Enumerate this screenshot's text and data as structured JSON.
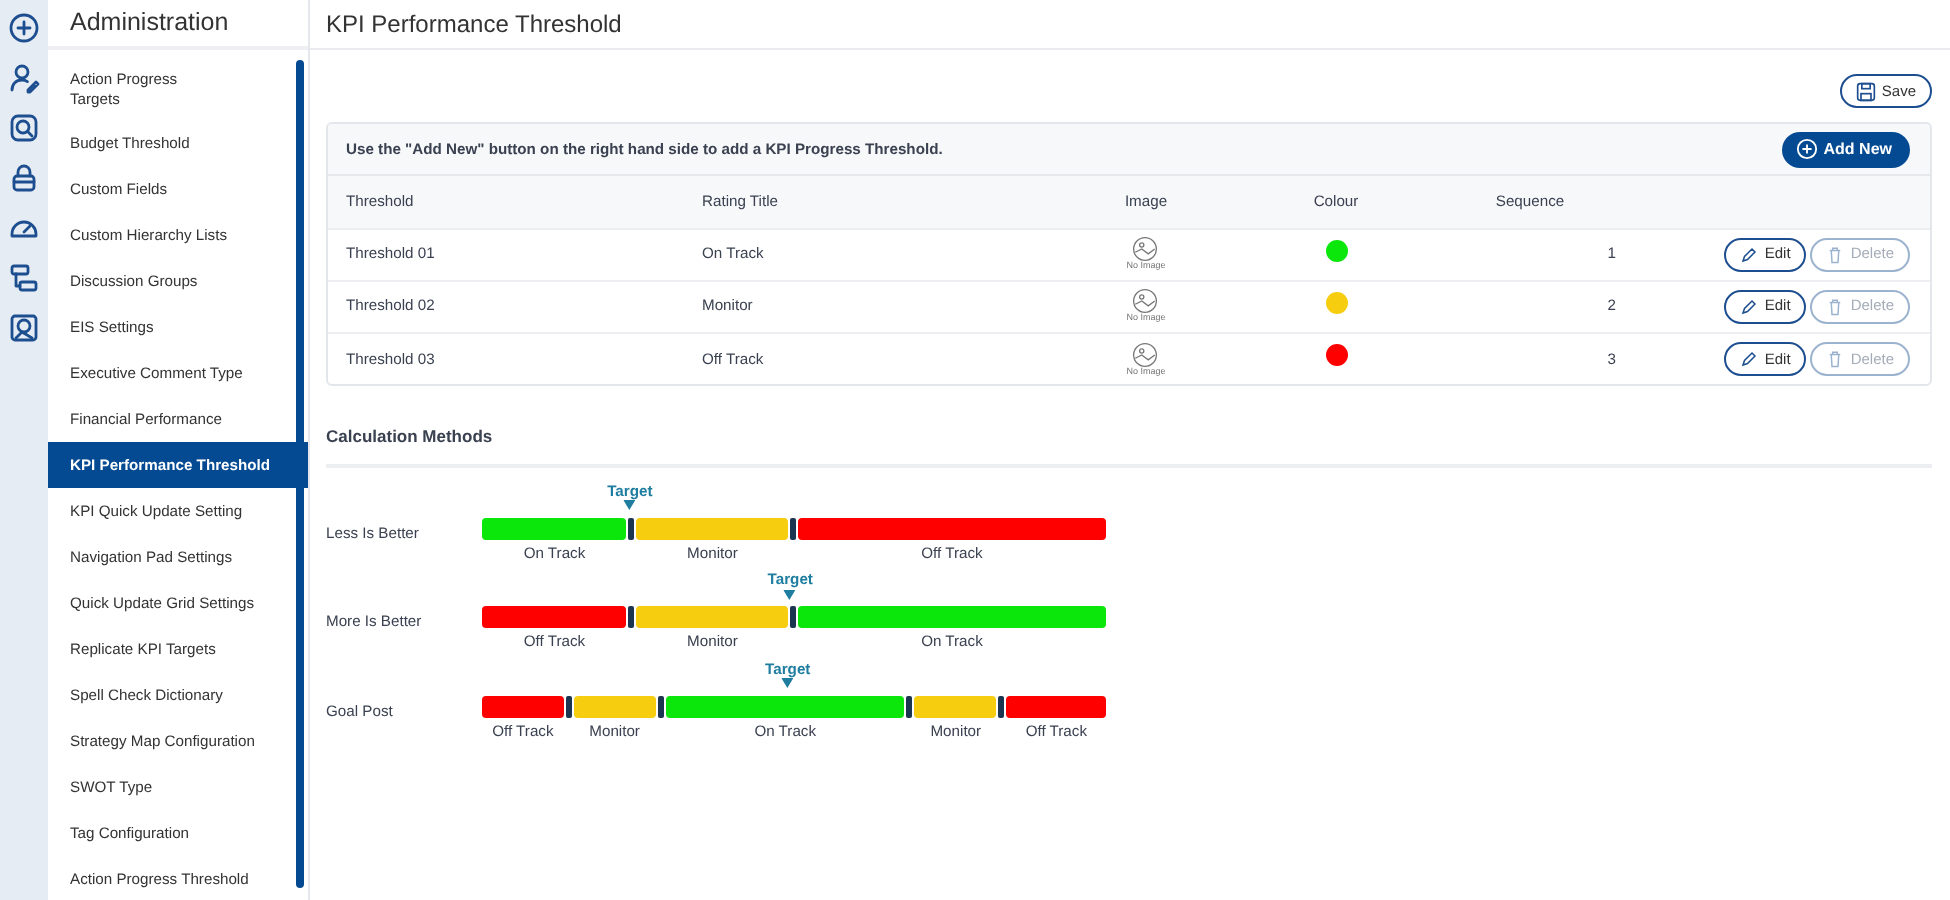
{
  "rail": {
    "items": [
      {
        "kind": "plus"
      },
      {
        "kind": "user"
      },
      {
        "kind": "search"
      },
      {
        "kind": "basket"
      },
      {
        "kind": "gauge"
      },
      {
        "kind": "blocks"
      },
      {
        "kind": "image"
      }
    ]
  },
  "sidebar": {
    "title": "Administration",
    "items": [
      {
        "label": "Action Progress Targets",
        "selected": false
      },
      {
        "label": "Budget Threshold",
        "selected": false
      },
      {
        "label": "Custom Fields",
        "selected": false
      },
      {
        "label": "Custom Hierarchy Lists",
        "selected": false
      },
      {
        "label": "Discussion Groups",
        "selected": false
      },
      {
        "label": "EIS Settings",
        "selected": false
      },
      {
        "label": "Executive Comment Type",
        "selected": false
      },
      {
        "label": "Financial Performance",
        "selected": false
      },
      {
        "label": "KPI Performance Threshold",
        "selected": true
      },
      {
        "label": "KPI Quick Update Setting",
        "selected": false
      },
      {
        "label": "Navigation Pad Settings",
        "selected": false
      },
      {
        "label": "Quick Update Grid Settings",
        "selected": false
      },
      {
        "label": "Replicate KPI Targets",
        "selected": false
      },
      {
        "label": "Spell Check Dictionary",
        "selected": false
      },
      {
        "label": "Strategy Map Configuration",
        "selected": false
      },
      {
        "label": "SWOT Type",
        "selected": false
      },
      {
        "label": "Tag Configuration",
        "selected": false
      },
      {
        "label": "Action Progress Threshold",
        "selected": false
      }
    ]
  },
  "page": {
    "title": "KPI Performance Threshold",
    "save_button": "Save"
  },
  "thresholds": {
    "hint": "Use the \"Add New\" button on the right hand side to add a KPI Progress Threshold.",
    "add_button": "Add New",
    "columns": [
      "Threshold",
      "Rating Title",
      "Image",
      "Colour",
      "Sequence"
    ],
    "rows": [
      {
        "threshold": "Threshold 01",
        "rating_title": "On Track",
        "image": "No Image",
        "color": "#0be60b",
        "sequence": "1",
        "edit": {
          "label": "Edit",
          "disabled": false
        },
        "delete": {
          "label": "Delete",
          "disabled": true
        }
      },
      {
        "threshold": "Threshold 02",
        "rating_title": "Monitor",
        "image": "No Image",
        "color": "#f6cd0f",
        "sequence": "2",
        "edit": {
          "label": "Edit",
          "disabled": false
        },
        "delete": {
          "label": "Delete",
          "disabled": true
        }
      },
      {
        "threshold": "Threshold 03",
        "rating_title": "Off Track",
        "image": "No Image",
        "color": "#fe0000",
        "sequence": "3",
        "edit": {
          "label": "Edit",
          "disabled": false
        },
        "delete": {
          "label": "Delete",
          "disabled": true
        }
      }
    ]
  },
  "calculation": {
    "title": "Calculation Methods",
    "methods": [
      {
        "kind": "less",
        "label": "Less Is Better",
        "target": "Target",
        "segments": [
          {
            "label": "On Track",
            "color": "#0be60b"
          },
          {
            "label": "Monitor",
            "color": "#f6cd0f"
          },
          {
            "label": "Off Track",
            "color": "#fe0000"
          }
        ]
      },
      {
        "kind": "more",
        "label": "More Is Better",
        "target": "Target",
        "segments": [
          {
            "label": "Off Track",
            "color": "#fe0000"
          },
          {
            "label": "Monitor",
            "color": "#f6cd0f"
          },
          {
            "label": "On Track",
            "color": "#0be60b"
          }
        ]
      },
      {
        "kind": "goal",
        "label": "Goal Post",
        "target": "Target",
        "segments": [
          {
            "label": "Off Track",
            "color": "#fe0000"
          },
          {
            "label": "Monitor",
            "color": "#f6cd0f"
          },
          {
            "label": "On Track",
            "color": "#0be60b"
          },
          {
            "label": "Monitor",
            "color": "#f6cd0f"
          },
          {
            "label": "Off Track",
            "color": "#fe0000"
          }
        ]
      }
    ]
  }
}
